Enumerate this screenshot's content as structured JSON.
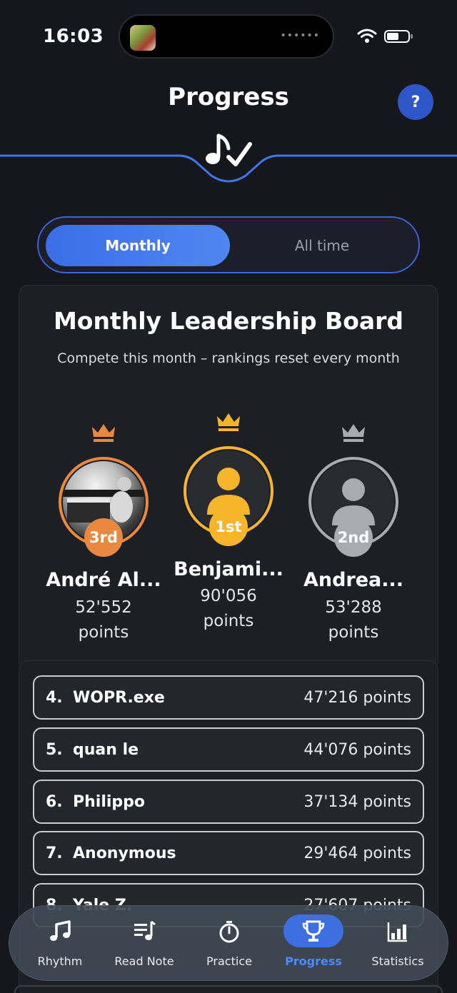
{
  "status_bar": {
    "time": "16:03",
    "island_dots": "••••••"
  },
  "header": {
    "title": "Progress",
    "help_label": "?"
  },
  "segment": {
    "active_label": "Monthly",
    "inactive_label": "All time"
  },
  "board": {
    "title": "Monthly Leadership Board",
    "subtitle": "Compete this month – rankings reset every month",
    "podium": [
      {
        "rank_label": "3rd",
        "name": "André Al...",
        "points": "52'552",
        "points_unit": "points",
        "crown_color": "#e8893f"
      },
      {
        "rank_label": "1st",
        "name": "Benjami...",
        "points": "90'056",
        "points_unit": "points",
        "crown_color": "#f7b52c"
      },
      {
        "rank_label": "2nd",
        "name": "Andrea...",
        "points": "53'288",
        "points_unit": "points",
        "crown_color": "#a9abb0"
      }
    ]
  },
  "leaderboard": [
    {
      "rank": "4.",
      "name": "WOPR.exe",
      "points": "47'216 points"
    },
    {
      "rank": "5.",
      "name": "quan le",
      "points": "44'076 points"
    },
    {
      "rank": "6.",
      "name": "Philippo",
      "points": "37'134 points"
    },
    {
      "rank": "7.",
      "name": "Anonymous",
      "points": "29'464 points"
    },
    {
      "rank": "8.",
      "name": "Yale Z.",
      "points": "27'607 points"
    }
  ],
  "tabs": [
    {
      "label": "Rhythm",
      "icon": "music-note-icon"
    },
    {
      "label": "Read Note",
      "icon": "read-note-icon"
    },
    {
      "label": "Practice",
      "icon": "stopwatch-icon"
    },
    {
      "label": "Progress",
      "icon": "trophy-icon",
      "active": true
    },
    {
      "label": "Statistics",
      "icon": "bar-chart-icon"
    }
  ],
  "colors": {
    "accent": "#3e6fe0",
    "gold": "#f7b52c",
    "bronze": "#e8893f",
    "silver": "#a9abb0",
    "background": "#15171c"
  }
}
